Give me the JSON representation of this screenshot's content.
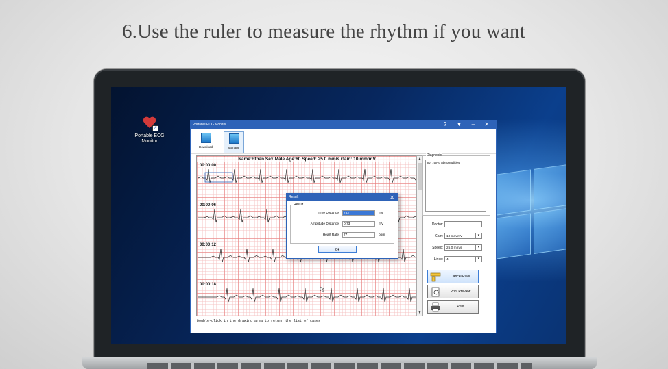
{
  "caption": "6.Use the ruler to measure the rhythm if you want",
  "desktop": {
    "icon_label_line1": "Portable ECG",
    "icon_label_line2": "Monitor"
  },
  "app": {
    "title": "Portable ECG Monitor",
    "controls": "? ▼ – ✕",
    "toolbar": {
      "download_label": "Download",
      "manage_label": "Manage"
    },
    "ecg_header": "Name:Ethan Sex:Male Age:60  Speed: 25.0 mm/s  Gain: 10 mm/mV",
    "timestamps": [
      "00:00:00",
      "00:00:06",
      "00:00:12",
      "00:00:18"
    ],
    "status": "Double-click in the drawing area to return the list of cases",
    "diagnosis": {
      "legend": "Diagnosis",
      "text": "ID: 75  No Abnormalities"
    },
    "doctor_label": "Doctor:",
    "doctor_value": "",
    "gain_label": "Gain:",
    "gain_value": "10 mm/mV",
    "speed_label": "Speed:",
    "speed_value": "25.0 mm/s",
    "lines_label": "Lines:",
    "lines_value": "4",
    "buttons": {
      "cancel_ruler": "Cancel Ruler",
      "print_preview": "Print Preview",
      "print": "Print"
    }
  },
  "dialog": {
    "title": "Result",
    "group_legend": "Result",
    "time_label": "Time Distance",
    "time_value": "782",
    "time_unit": "ms",
    "amplitude_label": "Amplitude Distance",
    "amplitude_value": "0.73",
    "amplitude_unit": "mV",
    "heart_label": "Heart Rate",
    "heart_value": "77",
    "heart_unit": "bpm",
    "ok_label": "Ok"
  }
}
